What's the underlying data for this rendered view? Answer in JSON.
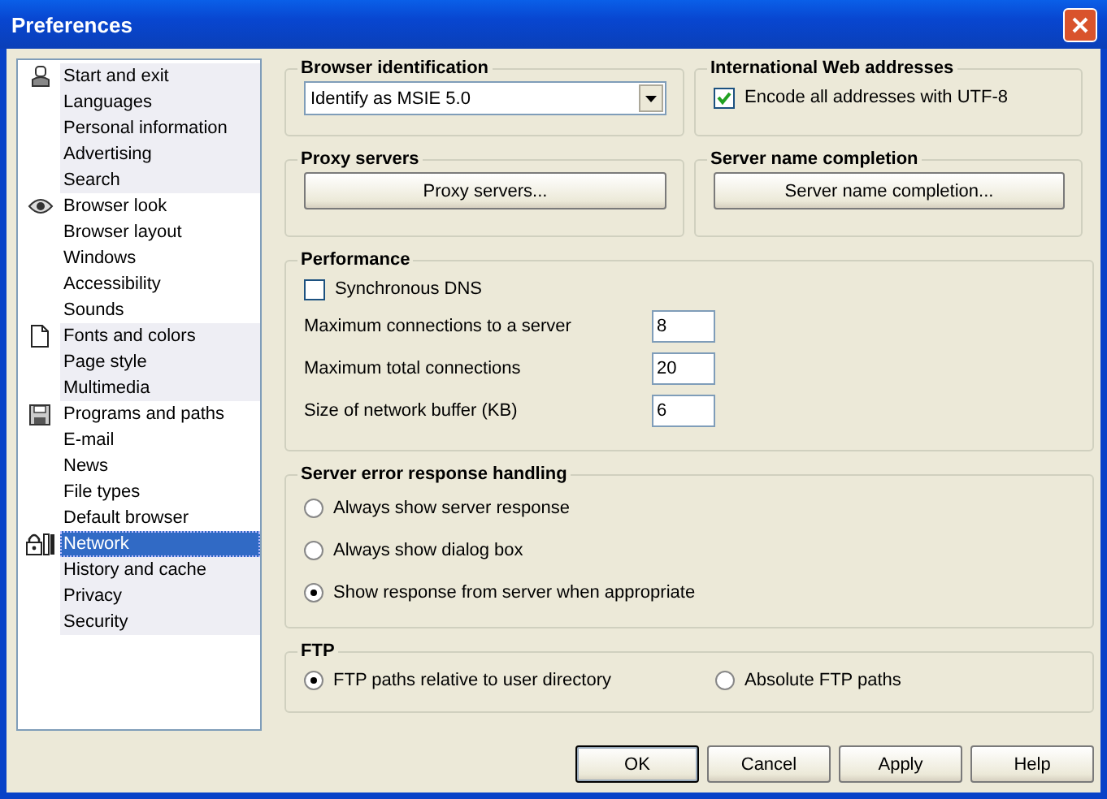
{
  "window": {
    "title": "Preferences"
  },
  "sidebar": {
    "groups": [
      {
        "items": [
          {
            "label": "Start and exit",
            "selected": false
          },
          {
            "label": "Languages",
            "selected": false
          },
          {
            "label": "Personal information",
            "selected": false
          },
          {
            "label": "Advertising",
            "selected": false
          },
          {
            "label": "Search",
            "selected": false
          }
        ]
      },
      {
        "items": [
          {
            "label": "Browser look",
            "selected": false
          },
          {
            "label": "Browser layout",
            "selected": false
          },
          {
            "label": "Windows",
            "selected": false
          },
          {
            "label": "Accessibility",
            "selected": false
          },
          {
            "label": "Sounds",
            "selected": false
          }
        ]
      },
      {
        "items": [
          {
            "label": "Fonts and colors",
            "selected": false
          },
          {
            "label": "Page style",
            "selected": false
          },
          {
            "label": "Multimedia",
            "selected": false
          }
        ]
      },
      {
        "items": [
          {
            "label": "Programs and paths",
            "selected": false
          },
          {
            "label": "E-mail",
            "selected": false
          },
          {
            "label": "News",
            "selected": false
          },
          {
            "label": "File types",
            "selected": false
          },
          {
            "label": "Default browser",
            "selected": false
          }
        ]
      },
      {
        "items": [
          {
            "label": "Network",
            "selected": true
          },
          {
            "label": "History and cache",
            "selected": false
          },
          {
            "label": "Privacy",
            "selected": false
          },
          {
            "label": "Security",
            "selected": false
          }
        ]
      }
    ]
  },
  "browser_identification": {
    "title": "Browser identification",
    "dropdown": {
      "value": "Identify as MSIE 5.0"
    }
  },
  "international_web_addresses": {
    "title": "International Web addresses",
    "checkbox": {
      "label": "Encode all addresses with UTF-8",
      "checked": true
    }
  },
  "proxy_servers": {
    "title": "Proxy servers",
    "button": "Proxy servers..."
  },
  "server_name_completion": {
    "title": "Server name completion",
    "button": "Server name completion..."
  },
  "performance": {
    "title": "Performance",
    "checkbox": {
      "label": "Synchronous DNS",
      "checked": false
    },
    "fields": [
      {
        "label": "Maximum connections to a server",
        "value": "8"
      },
      {
        "label": "Maximum total connections",
        "value": "20"
      },
      {
        "label": "Size of network buffer (KB)",
        "value": "6"
      }
    ]
  },
  "server_error_response_handling": {
    "title": "Server error response handling",
    "options": [
      {
        "label": "Always show server response",
        "selected": false
      },
      {
        "label": "Always show dialog box",
        "selected": false
      },
      {
        "label": "Show response from server when appropriate",
        "selected": true
      }
    ]
  },
  "ftp": {
    "title": "FTP",
    "options": [
      {
        "label": "FTP paths relative to user directory",
        "selected": true
      },
      {
        "label": "Absolute FTP paths",
        "selected": false
      }
    ]
  },
  "buttons": [
    {
      "label": "OK",
      "default": true
    },
    {
      "label": "Cancel",
      "default": false
    },
    {
      "label": "Apply",
      "default": false
    },
    {
      "label": "Help",
      "default": false
    }
  ]
}
